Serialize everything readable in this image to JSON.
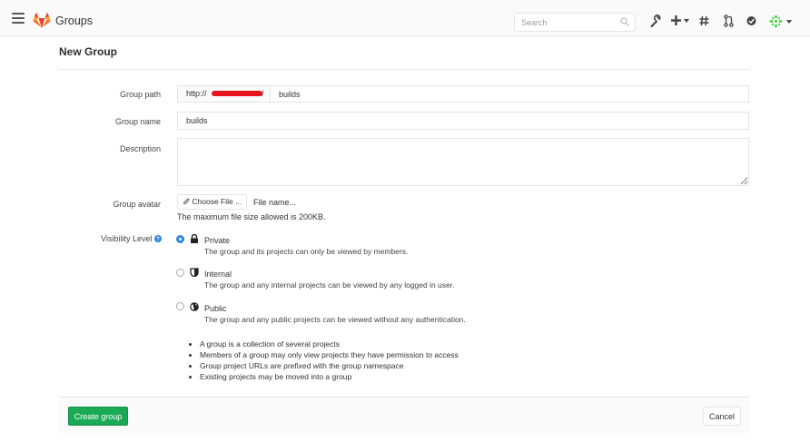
{
  "header": {
    "app_title": "Groups",
    "search": {
      "placeholder": "Search",
      "value": ""
    },
    "icons": [
      "hamburger-icon",
      "gitlab-logo",
      "search-icon",
      "wrench-icon",
      "plus-icon",
      "hash-icon",
      "merge-request-icon",
      "todo-check-icon",
      "user-avatar"
    ]
  },
  "page": {
    "title": "New Group"
  },
  "form": {
    "group_path": {
      "label": "Group path",
      "prefix": "http://",
      "prefix_suffix": "/",
      "value": "builds"
    },
    "group_name": {
      "label": "Group name",
      "value": "builds"
    },
    "description": {
      "label": "Description",
      "value": ""
    },
    "group_avatar": {
      "label": "Group avatar",
      "button_label": "Choose File ...",
      "file_name": "File name...",
      "help": "The maximum file size allowed is 200KB."
    },
    "visibility": {
      "label": "Visibility Level",
      "selected": "Private",
      "options": [
        {
          "title": "Private",
          "desc": "The group and its projects can only be viewed by members."
        },
        {
          "title": "Internal",
          "desc": "The group and any internal projects can be viewed by any logged in user."
        },
        {
          "title": "Public",
          "desc": "The group and any public projects can be viewed without any authentication."
        }
      ]
    },
    "info": [
      "A group is a collection of several projects",
      "Members of a group may only view projects they have permission to access",
      "Group project URLs are prefixed with the group namespace",
      "Existing projects may be moved into a group"
    ]
  },
  "footer": {
    "create_label": "Create group",
    "cancel_label": "Cancel"
  },
  "colors": {
    "accent_green": "#1aaa55",
    "radio_blue": "#2e86de",
    "logo_orange": "#e24329"
  }
}
